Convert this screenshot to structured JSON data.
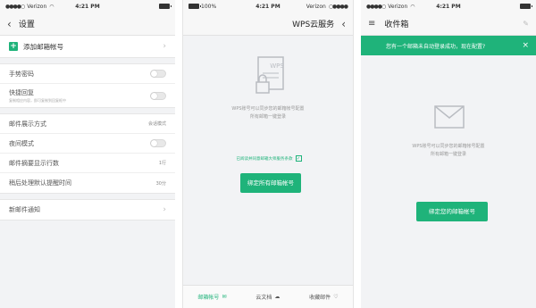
{
  "status": {
    "carrier": "Verizon",
    "time": "4:21 PM",
    "battery": "100%"
  },
  "screen1": {
    "nav_title": "设置",
    "add_account": "添加邮箱帐号",
    "gesture_password": "手势密码",
    "quick_reply": "快捷回复",
    "quick_reply_sub": "复制相应内容，即可复制到回复框中",
    "display_mode_label": "邮件展示方式",
    "display_mode_value": "会话模式",
    "night_mode": "夜间模式",
    "summary_lines_label": "邮件摘要显示行数",
    "summary_lines_value": "1行",
    "reminder_label": "稍后处理默认提醒时间",
    "reminder_value": "30分",
    "new_mail": "新邮件通知"
  },
  "screen2": {
    "nav_title": "WPS云服务",
    "doc_label": "WPS",
    "description_line1": "WPS账号可以同步您的邮箱帐号配置",
    "description_line2": "所有邮箱一键登录",
    "checkbox_text": "已阅读并同意邮箱大师服务条款",
    "button": "绑定所有邮箱帐号",
    "tabs": [
      "邮箱帐号",
      "云文档",
      "收藏邮件"
    ]
  },
  "screen3": {
    "nav_title": "收件箱",
    "banner": "您有一个邮箱未自动登录成功，现在配置?",
    "description_line1": "WPS账号可以同步您的邮箱帐号配置",
    "description_line2": "所有邮箱一键登录",
    "button": "绑定您的邮箱帐号"
  },
  "colors": {
    "accent": "#1fb37a",
    "background": "#f2f3f5"
  }
}
